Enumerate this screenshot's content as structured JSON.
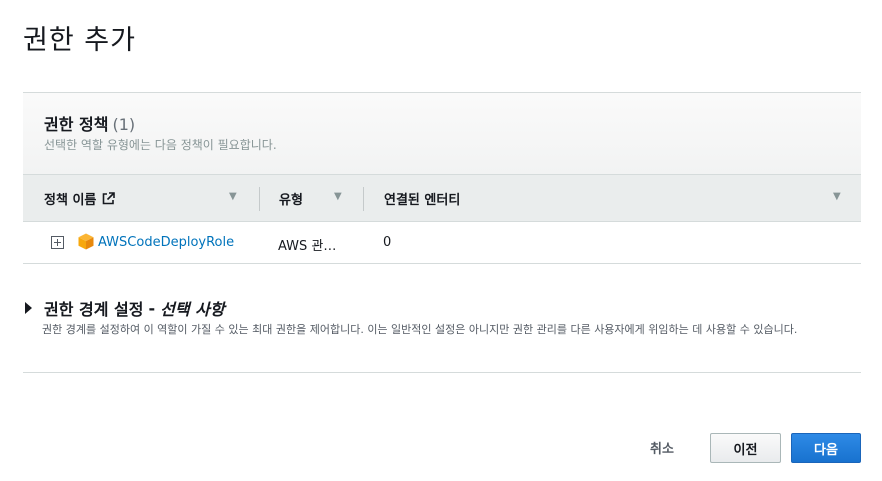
{
  "page": {
    "title": "권한 추가"
  },
  "policies": {
    "title": "권한 정책",
    "count": "(1)",
    "description": "선택한 역할 유형에는 다음 정책이 필요합니다.",
    "columns": {
      "name": "정책 이름",
      "type": "유형",
      "attached": "연결된 엔터티"
    },
    "rows": [
      {
        "name": "AWSCodeDeployRole",
        "type": "AWS 관리형",
        "attached": "0"
      }
    ]
  },
  "boundary": {
    "title": "권한 경계 설정",
    "dash": "-",
    "optional": "선택 사항",
    "description": "권한 경계를 설정하여 이 역할이 가질 수 있는 최대 권한을 제어합니다. 이는 일반적인 설정은 아니지만 권한 관리를 다른 사용자에게 위임하는 데 사용할 수 있습니다."
  },
  "footer": {
    "cancel": "취소",
    "previous": "이전",
    "next": "다음"
  },
  "colors": {
    "link": "#0073bb",
    "primary_button": "#1872cf",
    "cube_icon": "#f7a80d"
  },
  "icons": {
    "external_link": "external-link-icon",
    "expand": "expand-plus-icon",
    "policy": "aws-cube-icon",
    "sort": "sort-down-icon",
    "caret": "caret-right-icon"
  }
}
